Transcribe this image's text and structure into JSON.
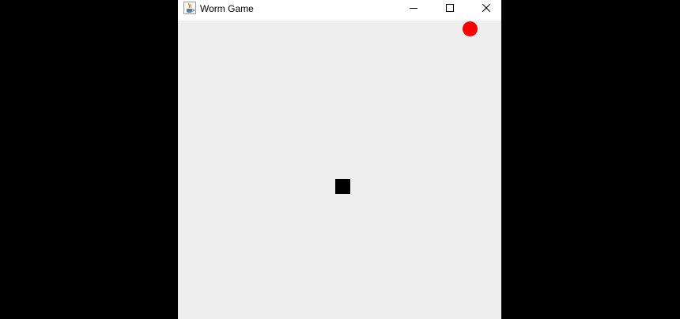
{
  "window": {
    "title": "Worm Game",
    "app_icon": "java-cup-icon",
    "controls": [
      "minimize-icon",
      "maximize-icon",
      "close-icon"
    ]
  },
  "game": {
    "background_color": "#eeeeee",
    "apple": {
      "shape": "circle",
      "color": "#ff0000"
    },
    "worm": {
      "segment_count": 1,
      "color": "#000000"
    }
  }
}
